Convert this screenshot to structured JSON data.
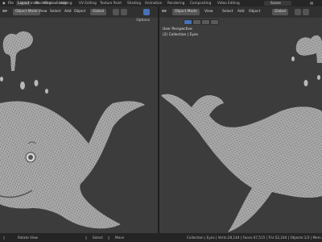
{
  "topbar": {
    "menus": [
      "File",
      "Edit",
      "Render",
      "Window",
      "Help"
    ],
    "workspaces": [
      "Layout",
      "Modeling",
      "Sculpting",
      "UV Editing",
      "Texture Paint",
      "Shading",
      "Animation",
      "Rendering",
      "Compositing",
      "Video Editing"
    ],
    "active_workspace": "Layout",
    "scene": "Scene"
  },
  "left_viewport": {
    "mode": "Object Mode",
    "menus": [
      "View",
      "Select",
      "Add",
      "Object"
    ],
    "transform": "Global",
    "options": "Options"
  },
  "right_viewport": {
    "mode": "Object Mode",
    "menus": [
      "View",
      "Select",
      "Add",
      "Object"
    ],
    "transform": "Global",
    "view_name": "User Perspective",
    "collection": "(2) Collection | Eyes"
  },
  "status_bar": {
    "left_hint": "Rotate View",
    "mid_hint1": "Select",
    "mid_hint2": "Move",
    "stats": "Collection | Eyes | Verts:28,144 | Faces:47,515 | Tris:52,244 | Objects:1/3 | Mem..."
  },
  "colors": {
    "accent": "#4772b3",
    "viewport_bg": "#3c3c3c",
    "mesh": "#b9b9b9"
  }
}
